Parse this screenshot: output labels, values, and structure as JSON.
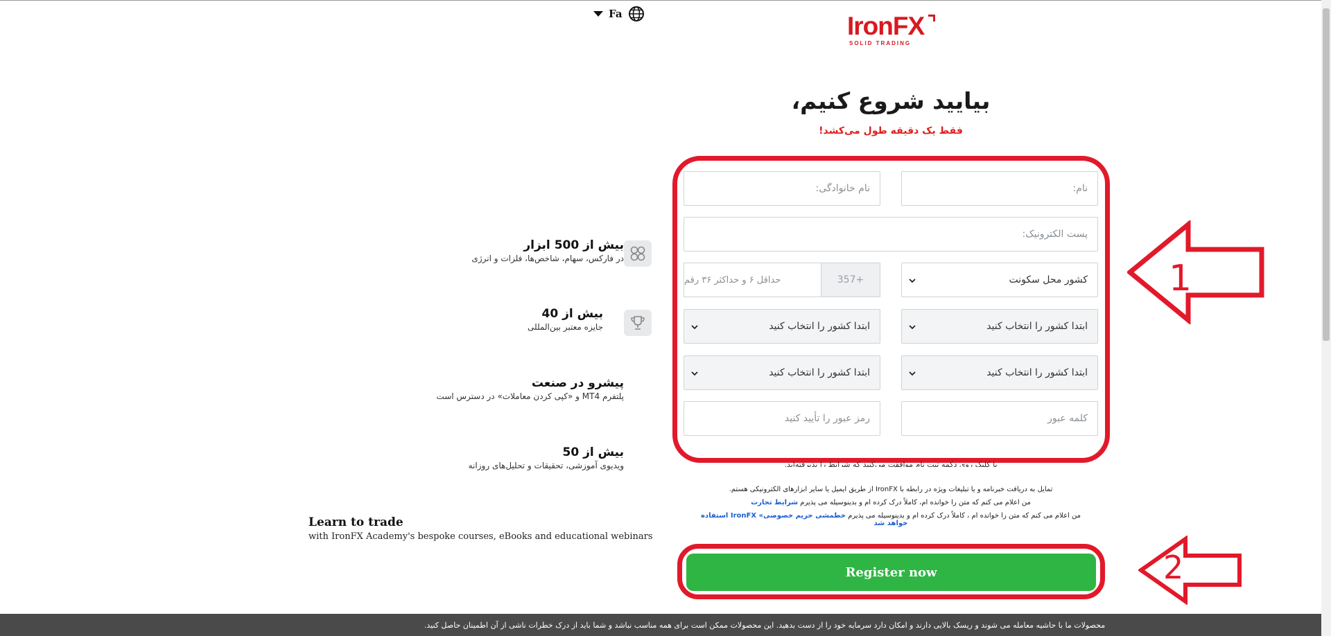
{
  "header": {
    "language_code": "Fa",
    "logo_brand": "IronFX",
    "logo_tagline": "SOLID TRADING"
  },
  "title": "بیایید شروع کنیم،",
  "subtitle": "فقط یک دقیقه طول می‌کشد!",
  "form": {
    "first_name_placeholder": "نام:",
    "last_name_placeholder": "نام خانوادگی:",
    "email_placeholder": "پست الکترونیک:",
    "country_placeholder": "کشور محل سکونت",
    "phone_code": "357+",
    "phone_placeholder": "حداقل ۶ و حداکثر ۳۶ رقم",
    "select_1_right": "ابتدا کشور را انتخاب کنید",
    "select_1_left": "ابتدا کشور را انتخاب کنید",
    "select_2_right": "ابتدا کشور را انتخاب کنید",
    "select_2_left": "ابتدا کشور را انتخاب کنید",
    "password_placeholder": "کلمه عبور",
    "confirm_password_placeholder": "رمز عبور را تأیید کنید"
  },
  "consent": {
    "partial_line": "با کلیک روی دکمه ثبت نام موافقت می‌کنید که شرایط را پذیرفته‌اید.",
    "newsletter": "تمایل به دریافت خبرنامه و یا تبلیغات ویژه در رابطه با IronFX از طریق ایمیل یا سایر ابزارهای الکترونیکی هستم.",
    "terms_text": "من اعلام می کنم که متن را خوانده ام، کاملاً درک کرده ام و بدینوسیله می پذیرم",
    "terms_link": "شرایط تجارت",
    "privacy_text": "من اعلام می کنم که متن را خوانده ام ، کاملاً درک کرده ام و بدینوسیله می پذیرم",
    "privacy_link": "خطمشی حریم خصوصی» IronFX استفاده خواهد شد"
  },
  "register_button": "Register now",
  "annotations": {
    "arrow_1": "1",
    "arrow_2": "2"
  },
  "features": [
    {
      "title": "بیش از 500 ابزار",
      "desc": "در فارکس، سهام، شاخص‌ها، فلزات و انرژی"
    },
    {
      "title": "بیش از 40",
      "desc": "جایزه معتبر بین‌المللی"
    },
    {
      "title": "پیشرو در صنعت",
      "desc": "پلتفرم MT4 و «کپی کردن معاملات» در دسترس است"
    },
    {
      "title": "بیش از 50",
      "desc": "ویدیوی آموزشی، تحقیقات و تحلیل‌های روزانه"
    }
  ],
  "learn": {
    "title": "Learn to trade",
    "desc": "with IronFX Academy's bespoke courses, eBooks and educational webinars"
  },
  "risk_warning": "محصولات ما با حاشیه معامله می شوند و ریسک بالایی دارند و امکان دارد سرمایه خود را از دست بدهید. این محصولات ممکن است برای همه مناسب نباشد و شما باید از درک خطرات ناشی از آن اطمینان حاصل کنید.",
  "colors": {
    "brand_red": "#d71920",
    "annotation_red": "#e2192a",
    "register_green": "#2fb543",
    "link_blue": "#1a5fd0"
  }
}
